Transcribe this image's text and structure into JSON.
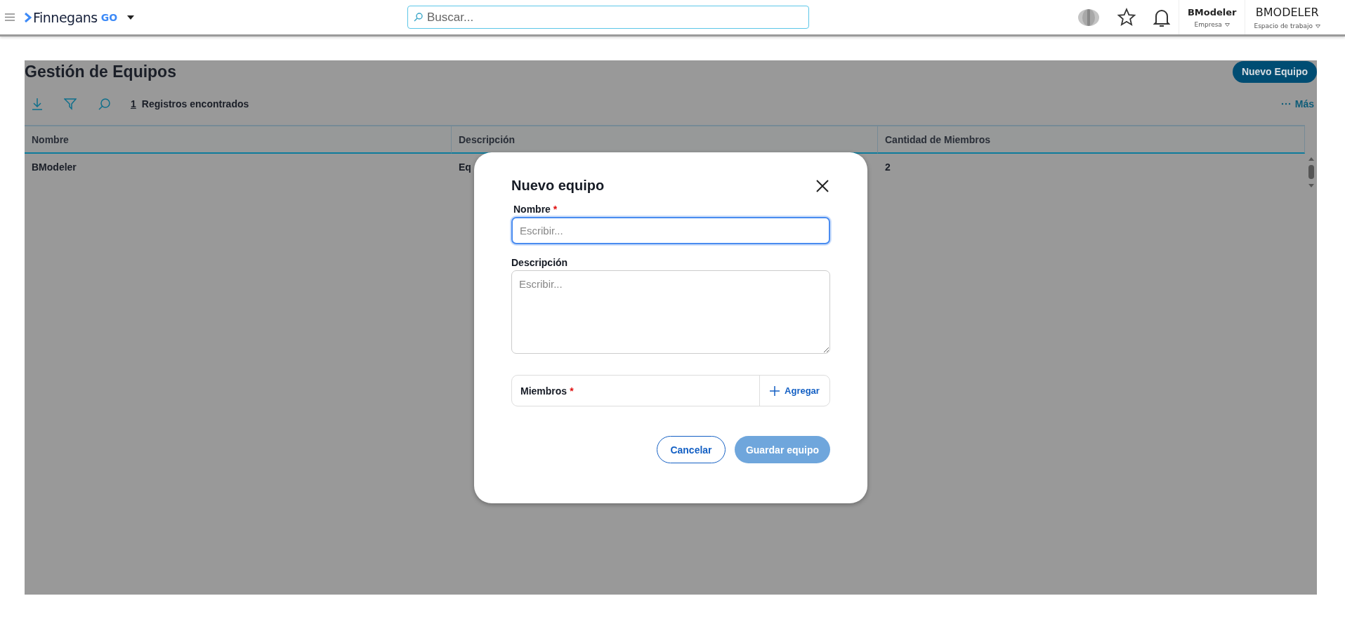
{
  "header": {
    "logo": {
      "name": "Finnegans",
      "suffix": "GO"
    },
    "search": {
      "placeholder": "Buscar..."
    },
    "company": {
      "name": "BModeler",
      "label": "Empresa"
    },
    "workspace": {
      "name": "BMODELER",
      "label": "Espacio de trabajo"
    }
  },
  "page": {
    "title": "Gestión de Equipos",
    "new_button": "Nuevo Equipo",
    "record_count": "1",
    "record_label": "Registros encontrados",
    "more": "Más",
    "table": {
      "columns": [
        "Nombre",
        "Descripción",
        "Cantidad de Miembros"
      ],
      "rows": [
        {
          "cells": [
            "BModeler",
            "Eq",
            "2"
          ]
        }
      ]
    }
  },
  "dialog": {
    "title": "Nuevo equipo",
    "required_mark": "*",
    "fields": [
      {
        "kind": "input",
        "label": "Nombre",
        "required": true,
        "focused": true,
        "placeholder": "Escribir..."
      },
      {
        "kind": "textarea",
        "label": "Descripción",
        "required": false,
        "focused": false,
        "placeholder": "Escribir..."
      }
    ],
    "members": {
      "label": "Miembros",
      "required": true,
      "add": "Agregar"
    },
    "buttons": [
      {
        "kind": "secondary",
        "label": "Cancelar",
        "disabled": false
      },
      {
        "kind": "primary",
        "label": "Guardar equipo",
        "disabled": true
      }
    ]
  }
}
